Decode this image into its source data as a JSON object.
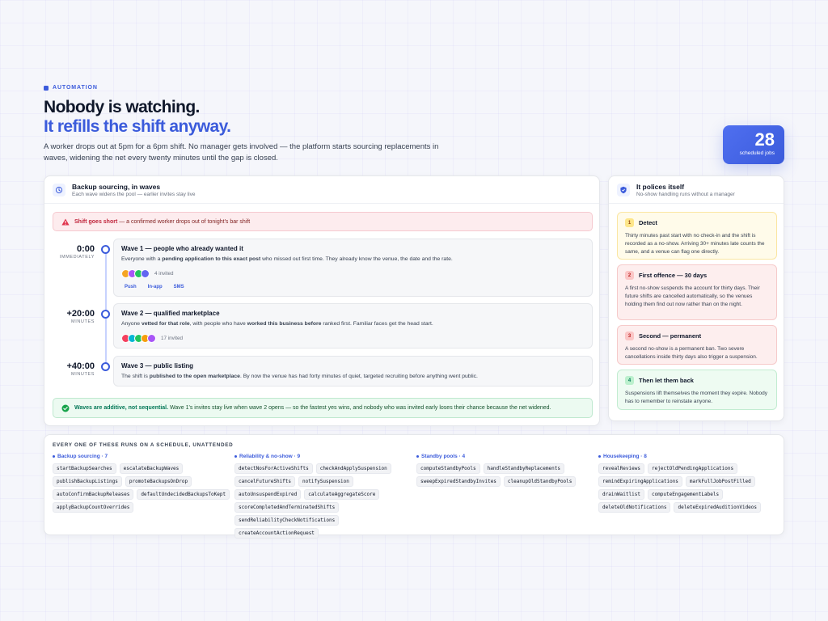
{
  "header": {
    "eyebrow": "AUTOMATION",
    "title_line1": "Nobody is watching.",
    "title_line2": "It refills the shift anyway.",
    "intro": "A worker drops out at 5pm for a 6pm shift. No manager gets involved — the platform starts sourcing replacements in waves, widening the net every twenty minutes until the gap is closed."
  },
  "kpi": {
    "value": "28",
    "label": "scheduled jobs"
  },
  "waves_card": {
    "title": "Backup sourcing, in waves",
    "subtitle": "Each wave widens the pool — earlier invites stay live",
    "alert": {
      "strong": "Shift goes short",
      "text": " — a confirmed worker drops out of tonight's bar shift"
    },
    "waves": [
      {
        "time": "0:00",
        "unit": "IMMEDIATELY",
        "title": "Wave 1 — people who already wanted it",
        "desc_a": "Everyone with a ",
        "desc_b": "pending application to this exact post",
        "desc_c": " who missed out first time. They already know the venue, the date and the rate.",
        "invited": "4 invited",
        "channels": [
          "Push",
          "In-app",
          "SMS"
        ],
        "avatar_colors": [
          "#f5a524",
          "#a855f7",
          "#22c55e",
          "#6366f1"
        ]
      },
      {
        "time": "+20:00",
        "unit": "MINUTES",
        "title": "Wave 2 — qualified marketplace",
        "desc_a": "Anyone ",
        "desc_b": "vetted for that role",
        "desc_c": ", with people who have ",
        "desc_d": "worked this business before",
        "desc_e": " ranked first. Familiar faces get the head start.",
        "invited": "17 invited",
        "avatar_colors": [
          "#f43f5e",
          "#06b6d4",
          "#22c55e",
          "#f59e0b",
          "#a855f7"
        ]
      },
      {
        "time": "+40:00",
        "unit": "MINUTES",
        "title": "Wave 3 — public listing",
        "desc_a": "The shift is ",
        "desc_b": "published to the open marketplace",
        "desc_c": ". By now the venue has had forty minutes of quiet, targeted recruiting before anything went public."
      }
    ],
    "note": {
      "strong": "Waves are additive, not sequential.",
      "text": " Wave 1's invites stay live when wave 2 opens — so the fastest yes wins, and nobody who was invited early loses their chance because the net widened."
    }
  },
  "polices_card": {
    "title": "It polices itself",
    "subtitle": "No-show handling runs without a manager",
    "items": [
      {
        "n": "1",
        "title": "Detect",
        "desc": "Thirty minutes past start with no check-in and the shift is recorded as a no-show. Arriving 30+ minutes late counts the same, and a venue can flag one directly."
      },
      {
        "n": "2",
        "title": "First offence — 30 days",
        "desc": "A first no-show suspends the account for thirty days. Their future shifts are cancelled automatically, so the venues holding them find out now rather than on the night."
      },
      {
        "n": "3",
        "title": "Second — permanent",
        "desc": "A second no-show is a permanent ban. Two severe cancellations inside thirty days also trigger a suspension."
      },
      {
        "n": "4",
        "title": "Then let them back",
        "desc": "Suspensions lift themselves the moment they expire. Nobody has to remember to reinstate anyone."
      }
    ]
  },
  "schedule": {
    "title": "EVERY ONE OF THESE RUNS ON A SCHEDULE, UNATTENDED",
    "groups": [
      {
        "title": "Backup sourcing · 7",
        "jobs": [
          "startBackupSearches",
          "escalateBackupWaves",
          "publishBackupListings",
          "promoteBackupsOnDrop",
          "autoConfirmBackupReleases",
          "defaultUndecidedBackupsToKept",
          "applyBackupCountOverrides"
        ]
      },
      {
        "title": "Reliability & no-show · 9",
        "jobs": [
          "detectNosForActiveShifts",
          "checkAndApplySuspension",
          "cancelFutureShifts",
          "notifySuspension",
          "autoUnsuspendExpired",
          "calculateAggregateScore",
          "scoreCompletedAndTerminatedShifts",
          "sendReliabilityCheckNotifications",
          "createAccountActionRequest"
        ]
      },
      {
        "title": "Standby pools · 4",
        "jobs": [
          "computeStandbyPools",
          "handleStandbyReplacements",
          "sweepExpiredStandbyInvites",
          "cleanupOldStandbyPools"
        ]
      },
      {
        "title": "Housekeeping · 8",
        "jobs": [
          "revealReviews",
          "rejectOldPendingApplications",
          "remindExpiringApplications",
          "markFullJobPostFilled",
          "drainWaitlist",
          "computeEngagementLabels",
          "deleteOldNotifications",
          "deleteExpiredAuditionVideos"
        ]
      }
    ]
  },
  "colors": {
    "accent": "#3b5bdb",
    "alert": "#c0243b",
    "success": "#047857"
  }
}
